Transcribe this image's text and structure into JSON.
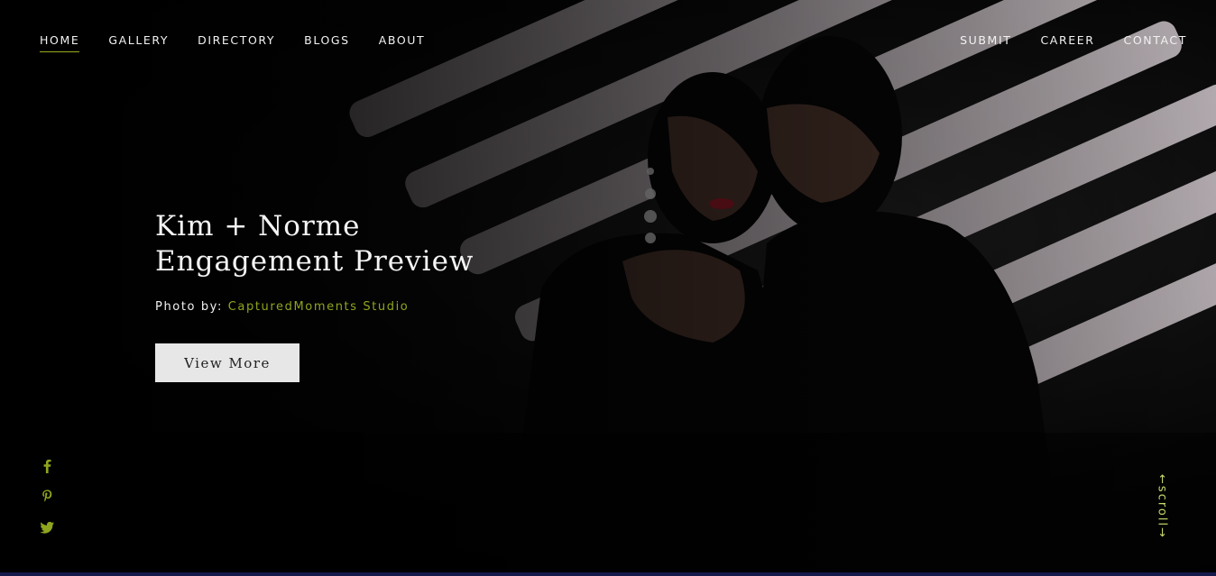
{
  "nav": {
    "left": [
      {
        "label": "HOME",
        "active": true
      },
      {
        "label": "GALLERY"
      },
      {
        "label": "DIRECTORY"
      },
      {
        "label": "BLOGS"
      },
      {
        "label": "ABOUT"
      }
    ],
    "right": [
      {
        "label": "SUBMIT"
      },
      {
        "label": "CAREER"
      },
      {
        "label": "CONTACT"
      }
    ]
  },
  "hero": {
    "title": "Kim + Norme Engagement Preview",
    "credit_prefix": "Photo by:",
    "credit_studio": "CapturedMoments Studio",
    "button_label": "View More"
  },
  "social": [
    {
      "icon": "facebook-icon"
    },
    {
      "icon": "pinterest-icon"
    },
    {
      "icon": "twitter-icon"
    }
  ],
  "scroll": {
    "label": "←scroll→"
  },
  "colors": {
    "accent": "#8fa51e",
    "button_bg": "#e7e7e7",
    "background": "#000000",
    "bottom_strip": "#141a4a"
  }
}
